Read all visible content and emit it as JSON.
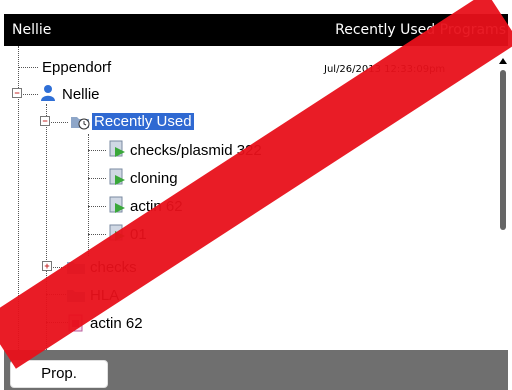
{
  "header": {
    "left_text": "Nellie",
    "right_text": "Recently Used Programs"
  },
  "tree": {
    "timestamp": "Jul/26/2013 12:33:09pm",
    "nodes": [
      {
        "label": "Eppendorf",
        "icon": "none"
      },
      {
        "label": "Nellie",
        "icon": "user-icon",
        "expander": "−"
      },
      {
        "label": "Recently Used",
        "icon": "recent-folder-icon",
        "expander": "−",
        "selected": true
      },
      {
        "label": "checks/plasmid 322",
        "icon": "program-icon"
      },
      {
        "label": "cloning",
        "icon": "program-icon"
      },
      {
        "label": "actin 62",
        "icon": "program-icon"
      },
      {
        "label": "01",
        "icon": "program-icon"
      },
      {
        "label": "checks",
        "icon": "folder-icon",
        "expander": "+"
      },
      {
        "label": "HLA",
        "icon": "folder-icon"
      },
      {
        "label": "actin 62",
        "icon": "document-icon"
      }
    ]
  },
  "bottom_bar": {
    "prop_label": "Prop."
  },
  "colors": {
    "header_bg": "#000000",
    "selection": "#2f69d2",
    "bottom_bar": "#6f6f6f",
    "watermark": "#e8101a"
  }
}
